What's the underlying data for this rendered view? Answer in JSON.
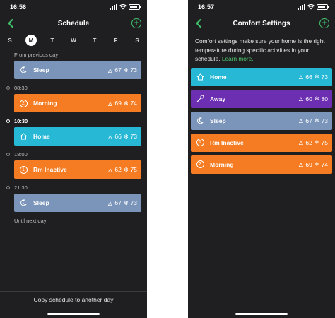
{
  "left": {
    "status": {
      "time": "16:56"
    },
    "nav": {
      "title": "Schedule"
    },
    "days": [
      "S",
      "M",
      "T",
      "W",
      "T",
      "F",
      "S"
    ],
    "timeline": {
      "from_label": "From previous day",
      "until_label": "Until next day",
      "entries": [
        {
          "time": "",
          "name": "Sleep",
          "heat": "67",
          "cool": "73",
          "icon": "moon-icon",
          "color": "#7a95b9"
        },
        {
          "time": "08:30",
          "name": "Morning",
          "heat": "69",
          "cool": "74",
          "icon": "number-2-icon",
          "num": "2",
          "color": "#f57c22"
        },
        {
          "time": "10:30",
          "name": "Home",
          "heat": "66",
          "cool": "73",
          "icon": "house-icon",
          "color": "#27b8d6"
        },
        {
          "time": "18:00",
          "name": "Rm Inactive",
          "heat": "62",
          "cool": "75",
          "icon": "number-1-icon",
          "num": "1",
          "color": "#f57c22"
        },
        {
          "time": "21:30",
          "name": "Sleep",
          "heat": "67",
          "cool": "73",
          "icon": "moon-icon",
          "color": "#7a95b9"
        }
      ]
    },
    "bottom_action": "Copy schedule to another day"
  },
  "right": {
    "status": {
      "time": "16:57"
    },
    "nav": {
      "title": "Comfort Settings"
    },
    "intro": "Comfort settings make sure your home is the right temperature during specific activities in your schedule.",
    "learn_more": "Learn more.",
    "settings": [
      {
        "name": "Home",
        "heat": "66",
        "cool": "73",
        "icon": "house-icon",
        "color": "#27b8d6"
      },
      {
        "name": "Away",
        "heat": "60",
        "cool": "80",
        "icon": "key-icon",
        "color": "#6c2fb1"
      },
      {
        "name": "Sleep",
        "heat": "67",
        "cool": "73",
        "icon": "moon-icon",
        "color": "#7a95b9"
      },
      {
        "name": "Rm Inactive",
        "heat": "62",
        "cool": "75",
        "icon": "number-1-icon",
        "num": "1",
        "color": "#f57c22"
      },
      {
        "name": "Morning",
        "heat": "69",
        "cool": "74",
        "icon": "number-2-icon",
        "num": "2",
        "color": "#f57c22"
      }
    ]
  },
  "colors": {
    "accent": "#41c06a",
    "background": "#1f1f21"
  }
}
